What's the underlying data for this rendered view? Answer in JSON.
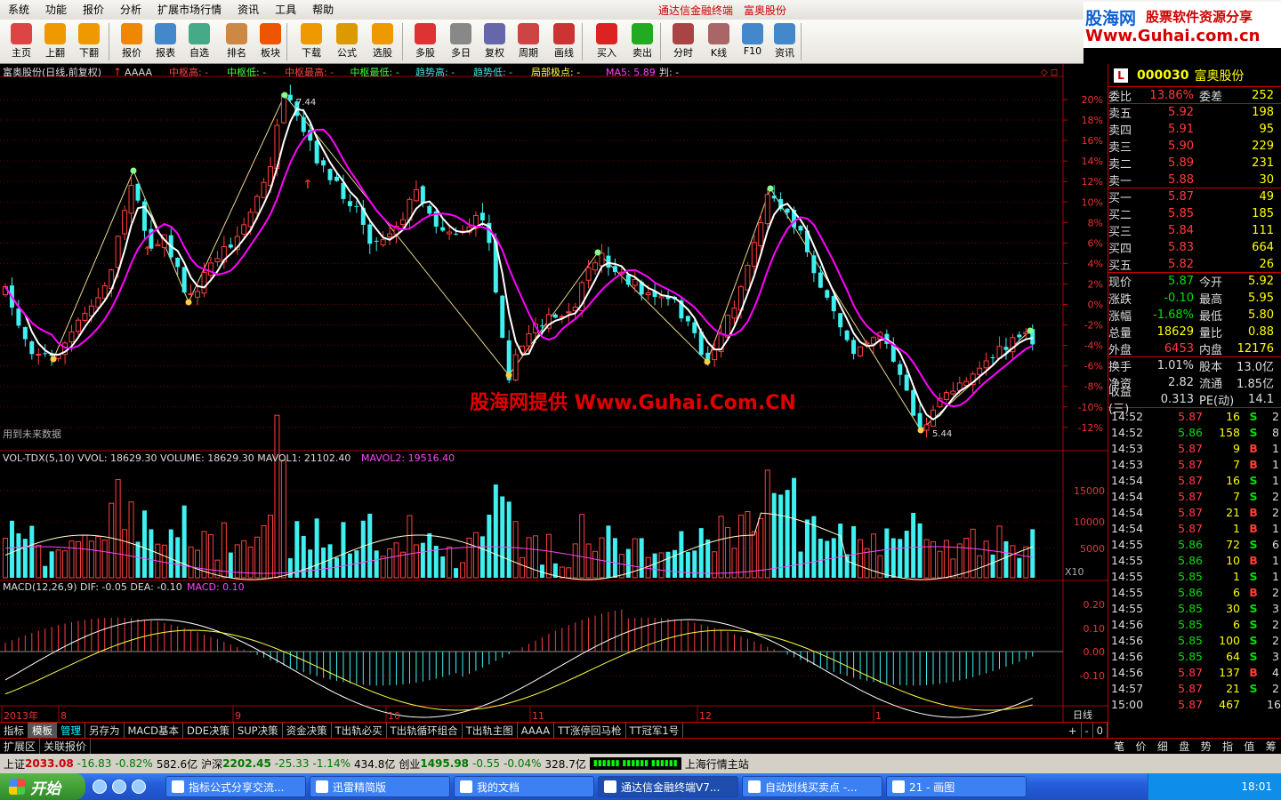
{
  "menu": {
    "items": [
      "系统",
      "功能",
      "报价",
      "分析",
      "扩展市场行情",
      "资讯",
      "工具",
      "帮助"
    ],
    "center_a": "通达信金融终端",
    "center_b": "富奥股份"
  },
  "logo": {
    "line1a": "股海网",
    "line1b": "股票软件资源分享",
    "line2": "Www.Guhai.com.cn"
  },
  "toolbar": [
    "主页",
    "上翻",
    "下翻",
    "报价",
    "报表",
    "自选",
    "排名",
    "板块",
    "下载",
    "公式",
    "选股",
    "多股",
    "多日",
    "复权",
    "周期",
    "画线",
    "买入",
    "卖出",
    "分时",
    "K线",
    "F10",
    "资讯"
  ],
  "chart": {
    "title": "富奥股份(日线,前复权)",
    "indicator_name": "AAAA",
    "legend": [
      {
        "t": "中枢高: -",
        "c": "#ff4040"
      },
      {
        "t": "中枢低: -",
        "c": "#40ff40"
      },
      {
        "t": "中枢最高: -",
        "c": "#ff4040"
      },
      {
        "t": "中枢最低: -",
        "c": "#40ff40"
      },
      {
        "t": "趋势高: -",
        "c": "#40e0e0"
      },
      {
        "t": "趋势低: -",
        "c": "#40e0e0"
      },
      {
        "t": "局部极点: -",
        "c": "#ffff40"
      },
      {
        "t": "MA5: 5.89",
        "c": "#ff40ff"
      },
      {
        "t": "判: -",
        "c": "#ddd"
      }
    ],
    "future_note": "用到未来数据",
    "peak_label": "7.44",
    "low_label": "5.44",
    "pct_ticks": [
      "20%",
      "18%",
      "16%",
      "14%",
      "12%",
      "10%",
      "8%",
      "6%",
      "4%",
      "2%",
      "0%",
      "-2%",
      "-4%",
      "-6%",
      "-8%",
      "-10%",
      "-12%"
    ],
    "watermark": "股海网提供 Www.Guhai.Com.CN",
    "vol_title": "VOL-TDX(5,10)  VVOL: 18629.30   VOLUME: 18629.30  MAVOL1: 21102.40",
    "vol_mavol2": "MAVOL2: 19516.40",
    "vol_ticks": [
      "15000",
      "10000",
      "5000"
    ],
    "vol_unit": "X10",
    "macd_title": "MACD(12,26,9)  DIF: -0.05  DEA: -0.10",
    "macd_val": "MACD: 0.10",
    "macd_ticks": [
      "0.20",
      "0.10",
      "0.00",
      "-0.10"
    ],
    "date_labels": [
      "2013年",
      "8",
      "9",
      "10",
      "11",
      "12",
      "1"
    ],
    "period": "日线"
  },
  "bottom_tabs": [
    "指标",
    "模板",
    "管理",
    "另存为",
    "MACD基本",
    "DDE决策",
    "SUP决策",
    "资金决策",
    "T出轨必买",
    "T出轨循环组合",
    "T出轨主图",
    "AAAA",
    "TT涨停回马枪",
    "TT冠军1号"
  ],
  "bottom_tabs_right": [
    "+",
    "-",
    "0"
  ],
  "sub_tabs": [
    "扩展区",
    "关联报价"
  ],
  "quote": {
    "code": "000030",
    "name": "富奥股份",
    "wb": {
      "l1": "委比",
      "v1": "13.86%",
      "l2": "委差",
      "v2": "252"
    },
    "sells": [
      {
        "l": "卖五",
        "p": "5.92",
        "v": "198"
      },
      {
        "l": "卖四",
        "p": "5.91",
        "v": "95"
      },
      {
        "l": "卖三",
        "p": "5.90",
        "v": "229"
      },
      {
        "l": "卖二",
        "p": "5.89",
        "v": "231"
      },
      {
        "l": "卖一",
        "p": "5.88",
        "v": "30"
      }
    ],
    "buys": [
      {
        "l": "买一",
        "p": "5.87",
        "v": "49"
      },
      {
        "l": "买二",
        "p": "5.85",
        "v": "185"
      },
      {
        "l": "买三",
        "p": "5.84",
        "v": "111"
      },
      {
        "l": "买四",
        "p": "5.83",
        "v": "664"
      },
      {
        "l": "买五",
        "p": "5.82",
        "v": "26"
      }
    ],
    "stats": [
      {
        "l1": "现价",
        "v1": "5.87",
        "c1": "green",
        "l2": "今开",
        "v2": "5.92",
        "c2": "red"
      },
      {
        "l1": "涨跌",
        "v1": "-0.10",
        "c1": "green",
        "l2": "最高",
        "v2": "5.95",
        "c2": "red"
      },
      {
        "l1": "涨幅",
        "v1": "-1.68%",
        "c1": "green",
        "l2": "最低",
        "v2": "5.80",
        "c2": "green"
      },
      {
        "l1": "总量",
        "v1": "18629",
        "c1": "yel",
        "l2": "量比",
        "v2": "0.88",
        "c2": "yel"
      },
      {
        "l1": "外盘",
        "v1": "6453",
        "c1": "red",
        "l2": "内盘",
        "v2": "12176",
        "c2": "green"
      }
    ],
    "stats2": [
      {
        "l1": "换手",
        "v1": "1.01%",
        "l2": "股本",
        "v2": "13.0亿"
      },
      {
        "l1": "净资",
        "v1": "2.82",
        "l2": "流通",
        "v2": "1.85亿"
      },
      {
        "l1": "收益(三)",
        "v1": "0.313",
        "l2": "PE(动)",
        "v2": "14.1"
      }
    ],
    "ticks": [
      [
        "14:52",
        "5.87",
        "16",
        "S",
        "2"
      ],
      [
        "14:52",
        "5.86",
        "158",
        "S",
        "8"
      ],
      [
        "14:53",
        "5.87",
        "9",
        "B",
        "1"
      ],
      [
        "14:53",
        "5.87",
        "7",
        "B",
        "1"
      ],
      [
        "14:54",
        "5.87",
        "16",
        "S",
        "1"
      ],
      [
        "14:54",
        "5.87",
        "7",
        "S",
        "2"
      ],
      [
        "14:54",
        "5.87",
        "21",
        "B",
        "2"
      ],
      [
        "14:54",
        "5.87",
        "1",
        "B",
        "1"
      ],
      [
        "14:55",
        "5.86",
        "72",
        "S",
        "6"
      ],
      [
        "14:55",
        "5.86",
        "10",
        "B",
        "1"
      ],
      [
        "14:55",
        "5.85",
        "1",
        "S",
        "1"
      ],
      [
        "14:55",
        "5.86",
        "6",
        "B",
        "2"
      ],
      [
        "14:55",
        "5.85",
        "30",
        "S",
        "3"
      ],
      [
        "14:56",
        "5.85",
        "6",
        "S",
        "2"
      ],
      [
        "14:56",
        "5.85",
        "100",
        "S",
        "2"
      ],
      [
        "14:56",
        "5.85",
        "64",
        "S",
        "3"
      ],
      [
        "14:56",
        "5.87",
        "137",
        "B",
        "4"
      ],
      [
        "14:57",
        "5.87",
        "21",
        "S",
        "2"
      ],
      [
        "15:00",
        "5.87",
        "467",
        "",
        "16"
      ]
    ],
    "tabs": [
      "笔",
      "价",
      "细",
      "盘",
      "势",
      "指",
      "值",
      "筹"
    ]
  },
  "status": {
    "sh": "上证",
    "sh_v": "2033.08",
    "sh_c": "-16.83",
    "sh_p": "-0.82%",
    "sh_a": "582.6亿",
    "hs": "沪深",
    "hs_v": "2202.45",
    "hs_c": "-25.33",
    "hs_p": "-1.14%",
    "hs_a": "434.8亿",
    "cy": "创业",
    "cy_v": "1495.98",
    "cy_c": "-0.55",
    "cy_p": "-0.04%",
    "cy_a": "328.7亿",
    "site": "上海行情主站"
  },
  "taskbar": {
    "start": "开始",
    "tasks": [
      "指标公式分享交流...",
      "迅雷精简版",
      "我的文档",
      "通达信金融终端V7...",
      "自动划线买卖点 -...",
      "21 - 画图"
    ],
    "clock": "18:01"
  }
}
